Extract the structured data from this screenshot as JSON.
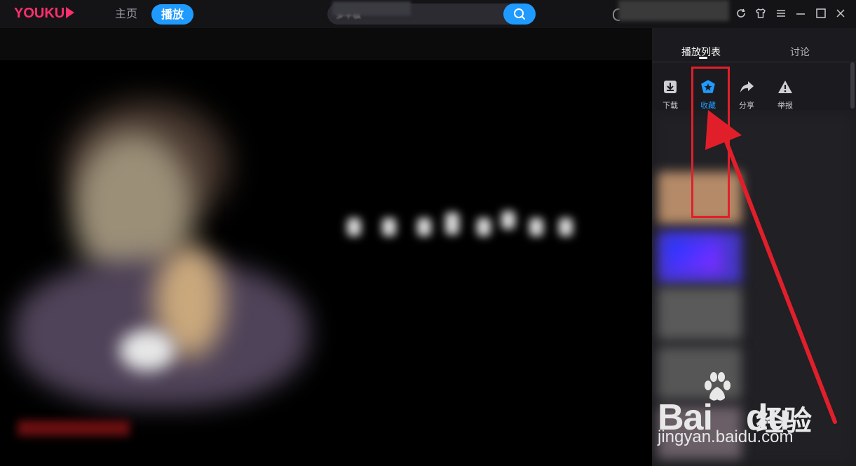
{
  "app": {
    "logo_text": "YOUKU"
  },
  "nav": {
    "home_label": "主页",
    "play_label": "播放"
  },
  "search": {
    "placeholder_text": "多半板"
  },
  "sidebar": {
    "tabs": [
      {
        "label": "播放列表",
        "active": true
      },
      {
        "label": "讨论",
        "active": false
      }
    ],
    "actions": [
      {
        "label": "下载",
        "icon": "download-icon",
        "active": false
      },
      {
        "label": "收藏",
        "icon": "favorite-icon",
        "active": true
      },
      {
        "label": "分享",
        "icon": "share-icon",
        "active": false
      },
      {
        "label": "举报",
        "icon": "report-icon",
        "active": false
      }
    ]
  },
  "watermark": {
    "brand_prefix": "Bai",
    "brand_suffix": "du",
    "brand_cn": "经验",
    "url": "jingyan.baidu.com"
  },
  "colors": {
    "accent": "#1f9bff",
    "logo": "#ff2f6d",
    "annotation": "#e11f2a"
  }
}
